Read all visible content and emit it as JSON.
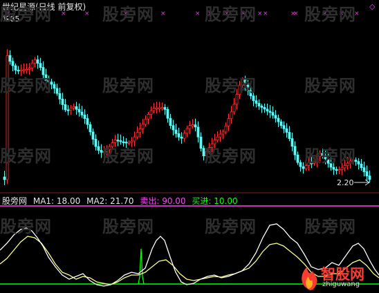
{
  "header": {
    "title": "世纪星源(日线 前复权)",
    "diamond": "◇"
  },
  "price_labels": {
    "high": "2.85",
    "low": "2.20"
  },
  "indicator": {
    "name": "股旁网",
    "ma1": "MA1: 18.00",
    "ma2": "MA2: 21.70",
    "sell": "卖出: 90.00",
    "buy": "买进: 10.00"
  },
  "watermark": "股旁网",
  "logo": {
    "name": "智股网",
    "url": "zhiguwang"
  },
  "colors": {
    "up": "#ff3232",
    "down": "#54fcfc",
    "ma1": "#ffffff",
    "ma2": "#ffff80",
    "sell": "#ff40ff",
    "buy": "#00ff00",
    "signal": "#d040d0",
    "title": "#e6e6e6"
  }
}
